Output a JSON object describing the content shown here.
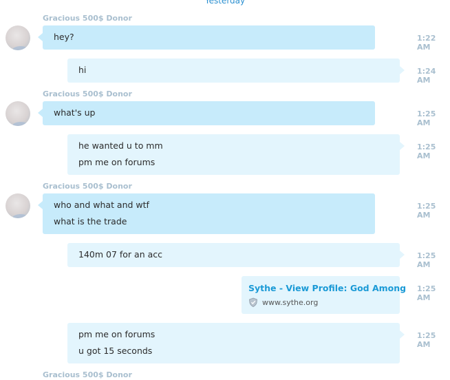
{
  "date_separator": "Yesterday",
  "sender_name": "Gracious 500$ Donor",
  "messages": [
    {
      "dir": "in",
      "lines": [
        "hey?"
      ],
      "time": "1:22 AM"
    },
    {
      "dir": "out",
      "lines": [
        "hi"
      ],
      "time": "1:24 AM"
    },
    {
      "dir": "in",
      "lines": [
        "what's up"
      ],
      "time": "1:25 AM"
    },
    {
      "dir": "out",
      "lines": [
        "he wanted u to mm",
        "pm me on forums"
      ],
      "time": "1:25 AM"
    },
    {
      "dir": "in",
      "lines": [
        "who and what and wtf",
        "what is the trade"
      ],
      "time": "1:25 AM"
    },
    {
      "dir": "out",
      "lines": [
        "140m 07 for an acc"
      ],
      "time": "1:25 AM"
    },
    {
      "dir": "out",
      "lines": [
        "pm me on forums",
        "u got 15 seconds"
      ],
      "time": "1:25 AM"
    }
  ],
  "link_preview": {
    "site": "Sythe",
    "separator": " - ",
    "title": "View Profile: God Among",
    "domain": "www.sythe.org",
    "time": "1:25 AM",
    "icon": "shield-icon"
  },
  "colors": {
    "incoming_bubble": "#c7ebfb",
    "outgoing_bubble": "#e3f5fd",
    "link": "#1b9ad6",
    "meta": "#a9bfcf"
  }
}
